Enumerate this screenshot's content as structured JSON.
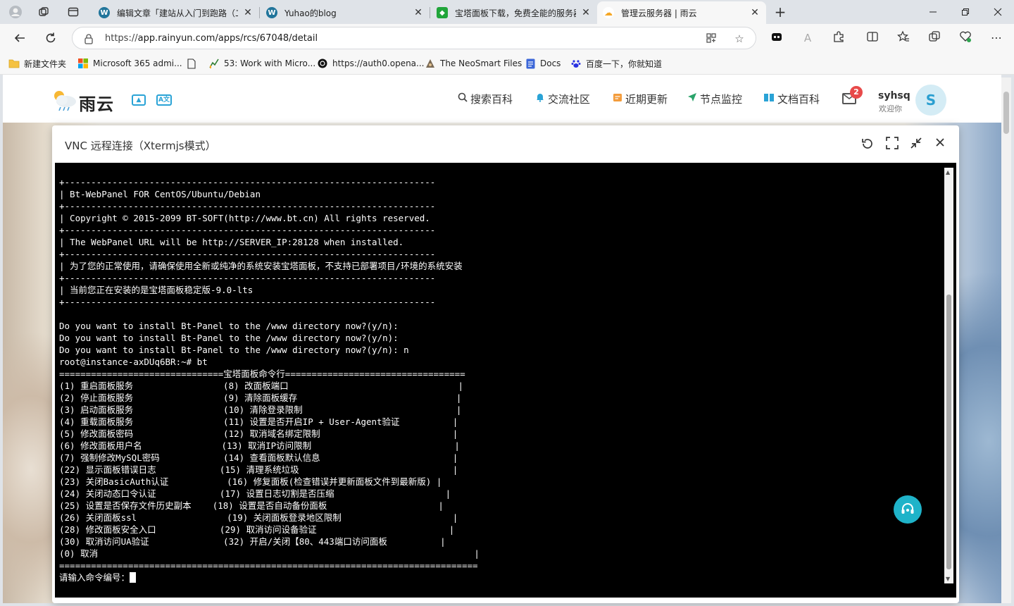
{
  "browser": {
    "tabs": [
      {
        "title": "编辑文章「建站从入门到跑路（二",
        "close": "✕"
      },
      {
        "title": "Yuhao的blog",
        "close": "✕"
      },
      {
        "title": "宝塔面板下载，免费全能的服务器",
        "close": "✕"
      },
      {
        "title": "管理云服务器 | 雨云",
        "close": "✕"
      }
    ],
    "new_tab": "+",
    "url_prefix": "https://",
    "url_main": "app.rainyun.com/apps/rcs/67048/detail",
    "bookmarks": [
      {
        "label": "新建文件夹"
      },
      {
        "label": "Microsoft 365 admi..."
      },
      {
        "label": ""
      },
      {
        "label": "53: Work with Micro..."
      },
      {
        "label": "https://auth0.opena..."
      },
      {
        "label": "The NeoSmart Files"
      },
      {
        "label": "Docs"
      },
      {
        "label": "百度一下，你就知道"
      }
    ]
  },
  "site": {
    "logo": "雨云",
    "nav": [
      {
        "label": "搜索百科",
        "icon": "search-icon"
      },
      {
        "label": "交流社区",
        "icon": "bell-icon"
      },
      {
        "label": "近期更新",
        "icon": "update-icon"
      },
      {
        "label": "节点监控",
        "icon": "send-icon"
      },
      {
        "label": "文档百科",
        "icon": "book-icon"
      }
    ],
    "mail_badge": "2",
    "user_name": "syhsq",
    "user_welcome": "欢迎你",
    "avatar_letter": "S"
  },
  "vnc": {
    "title": "VNC 远程连接（Xtermjs模式）",
    "lines": [
      "+----------------------------------------------------------------------",
      "| Bt-WebPanel FOR CentOS/Ubuntu/Debian",
      "+----------------------------------------------------------------------",
      "| Copyright © 2015-2099 BT-SOFT(http://www.bt.cn) All rights reserved.",
      "+----------------------------------------------------------------------",
      "| The WebPanel URL will be http://SERVER_IP:28128 when installed.",
      "+----------------------------------------------------------------------",
      "| 为了您的正常使用，请确保使用全新或纯净的系统安装宝塔面板，不支持已部署项目/环境的系统安装",
      "+----------------------------------------------------------------------",
      "| 当前您正在安装的是宝塔面板稳定版-9.0-lts",
      "+----------------------------------------------------------------------",
      "",
      "Do you want to install Bt-Panel to the /www directory now?(y/n):",
      "Do you want to install Bt-Panel to the /www directory now?(y/n):",
      "Do you want to install Bt-Panel to the /www directory now?(y/n): n",
      "root@instance-axDUq6BR:~# bt",
      "===============================宝塔面板命令行==================================",
      "(1) 重启面板服务                 (8) 改面板端口                                |",
      "(2) 停止面板服务                 (9) 清除面板缓存                              |",
      "(3) 启动面板服务                 (10) 清除登录限制                             |",
      "(4) 重载面板服务                 (11) 设置是否开启IP + User-Agent验证          |",
      "(5) 修改面板密码                 (12) 取消域名绑定限制                         |",
      "(6) 修改面板用户名               (13) 取消IP访问限制                           |",
      "(7) 强制修改MySQL密码            (14) 查看面板默认信息                         |",
      "(22) 显示面板错误日志            (15) 清理系统垃圾                             |",
      "(23) 关闭BasicAuth认证           (16) 修复面板(检查错误并更新面板文件到最新版) |",
      "(24) 关闭动态口令认证            (17) 设置日志切割是否压缩                     |",
      "(25) 设置是否保存文件历史副本    (18) 设置是否自动备份面板                     |",
      "(26) 关闭面板ssl                 (19) 关闭面板登录地区限制                     |",
      "(28) 修改面板安全入口            (29) 取消访问设备验证                         |",
      "(30) 取消访问UA验证              (32) 开启/关闭【80、443端口访问面板          |",
      "(0) 取消                                                                       |",
      "===============================================================================",
      "请输入命令编号："
    ]
  }
}
